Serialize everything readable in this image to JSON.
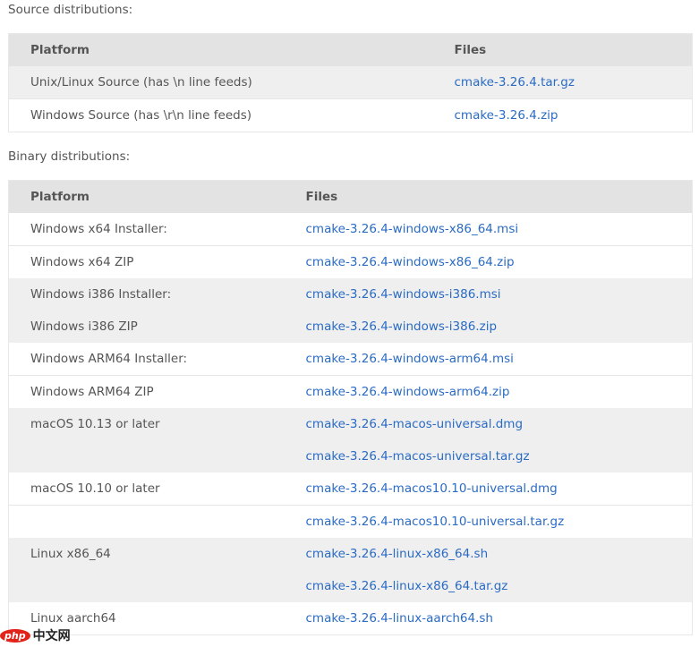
{
  "source": {
    "caption": "Source distributions:",
    "headers": [
      "Platform",
      "Files"
    ],
    "rows": [
      {
        "platform": "Unix/Linux Source (has \\n line feeds)",
        "file": "cmake-3.26.4.tar.gz",
        "gray": true,
        "sep": false
      },
      {
        "platform": "Windows Source (has \\r\\n line feeds)",
        "file": "cmake-3.26.4.zip",
        "gray": false,
        "sep": true
      }
    ]
  },
  "binary": {
    "caption": "Binary distributions:",
    "headers": [
      "Platform",
      "Files"
    ],
    "rows": [
      {
        "platform": "Windows x64 Installer:",
        "file": "cmake-3.26.4-windows-x86_64.msi",
        "gray": false,
        "sep": false
      },
      {
        "platform": "Windows x64 ZIP",
        "file": "cmake-3.26.4-windows-x86_64.zip",
        "gray": false,
        "sep": true
      },
      {
        "platform": "Windows i386 Installer:",
        "file": "cmake-3.26.4-windows-i386.msi",
        "gray": true,
        "sep": false
      },
      {
        "platform": "Windows i386 ZIP",
        "file": "cmake-3.26.4-windows-i386.zip",
        "gray": true,
        "sep": false
      },
      {
        "platform": "Windows ARM64 Installer:",
        "file": "cmake-3.26.4-windows-arm64.msi",
        "gray": false,
        "sep": false
      },
      {
        "platform": "Windows ARM64 ZIP",
        "file": "cmake-3.26.4-windows-arm64.zip",
        "gray": false,
        "sep": true
      },
      {
        "platform": "macOS 10.13 or later",
        "file": "cmake-3.26.4-macos-universal.dmg",
        "gray": true,
        "sep": false
      },
      {
        "platform": "",
        "file": "cmake-3.26.4-macos-universal.tar.gz",
        "gray": true,
        "sep": false
      },
      {
        "platform": "macOS 10.10 or later",
        "file": "cmake-3.26.4-macos10.10-universal.dmg",
        "gray": false,
        "sep": false
      },
      {
        "platform": "",
        "file": "cmake-3.26.4-macos10.10-universal.tar.gz",
        "gray": false,
        "sep": true
      },
      {
        "platform": "Linux x86_64",
        "file": "cmake-3.26.4-linux-x86_64.sh",
        "gray": true,
        "sep": false
      },
      {
        "platform": "",
        "file": "cmake-3.26.4-linux-x86_64.tar.gz",
        "gray": true,
        "sep": false
      },
      {
        "platform": "Linux aarch64",
        "file": "cmake-3.26.4-linux-aarch64.sh",
        "gray": false,
        "sep": false
      }
    ]
  },
  "watermark": {
    "logo": "php",
    "text": "中文网"
  }
}
